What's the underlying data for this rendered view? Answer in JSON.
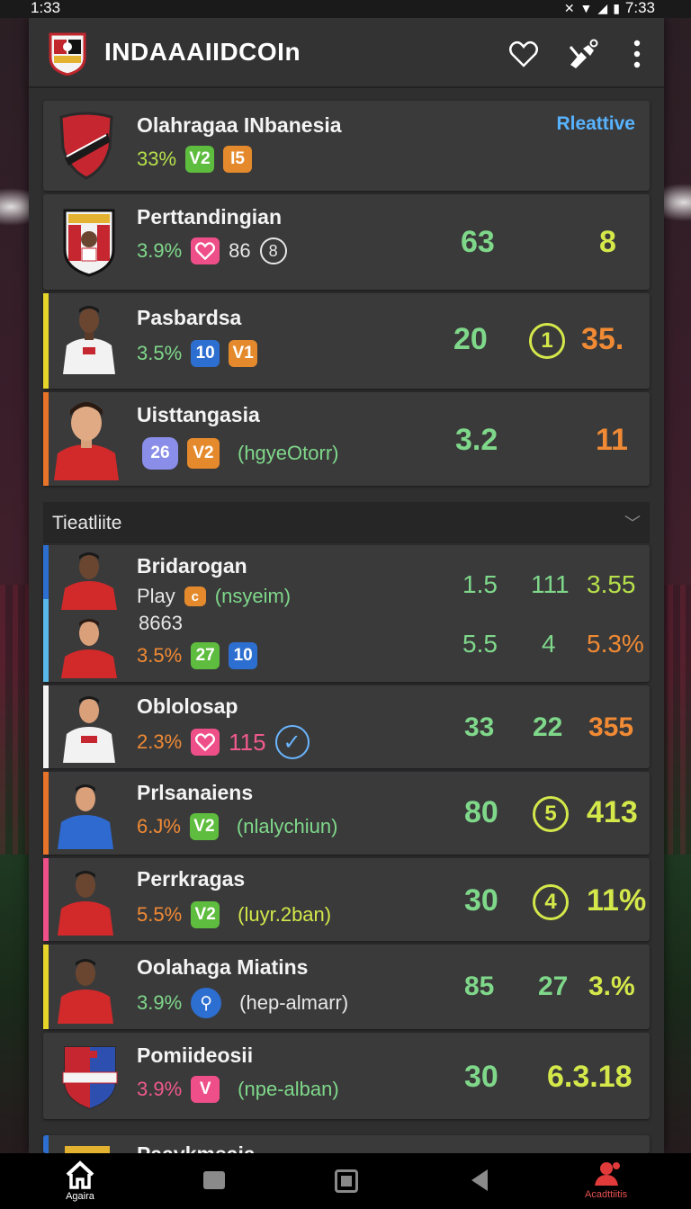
{
  "status": {
    "time_left": "1:33",
    "time_right": "7:33"
  },
  "app": {
    "title": "INDAAAIIDCOIn"
  },
  "top_cards": [
    {
      "name": "Olahragaa INbanesia",
      "pct": "33%",
      "badge1": "V2",
      "badge2": "I5",
      "link": "Rleattive"
    },
    {
      "name": "Perttandingian",
      "pct": "3.9%",
      "badge2": "86",
      "badge3": "8",
      "stat1": "63",
      "stat2": "8"
    },
    {
      "name": "Pasbardsa",
      "pct": "3.5%",
      "badge1": "10",
      "badge2": "V1",
      "stat1": "20",
      "stat_circ": "1",
      "stat2": "35."
    },
    {
      "name": "Uisttangasia",
      "badge1": "26",
      "badge2": "V2",
      "tag": "(hgyeOtorr)",
      "stat1": "3.2",
      "stat2": "11"
    }
  ],
  "section": {
    "title": "Tieatliite"
  },
  "list_cards": [
    {
      "name": "Bridarogan",
      "line2_label": "Play",
      "line2_badge": "c",
      "line2_tag": "(nsyeim)",
      "line3": "8663",
      "pct": "3.5%",
      "badge1": "27",
      "badge2": "10",
      "stats_top": [
        "1.5",
        "111",
        "3.55"
      ],
      "stats_bottom": [
        "5.5",
        "4",
        "5.3%"
      ]
    },
    {
      "name": "Oblolosap",
      "pct": "2.3%",
      "num": "115",
      "stats": [
        "33",
        "22",
        "355"
      ]
    },
    {
      "name": "Prlsanaiens",
      "pct": "6.J%",
      "badge": "V2",
      "tag": "(nlalychiun)",
      "stats": [
        "80",
        "5",
        "413"
      ]
    },
    {
      "name": "Perrkragas",
      "pct": "5.5%",
      "badge": "V2",
      "tag": "(luyr.2ban)",
      "stats": [
        "30",
        "4",
        "11%"
      ]
    },
    {
      "name": "Oolahaga Miatins",
      "pct": "3.9%",
      "tag": "(hep-almarr)",
      "stats": [
        "85",
        "27",
        "3.%"
      ]
    },
    {
      "name": "Pomiideosii",
      "pct": "3.9%",
      "badge": "V",
      "tag": "(npe-alban)",
      "stats": [
        "30",
        "6.3.18"
      ]
    },
    {
      "name": "Paavkmsaia"
    }
  ],
  "nav": {
    "left": "Agaira",
    "right": "Acadttiitis"
  }
}
